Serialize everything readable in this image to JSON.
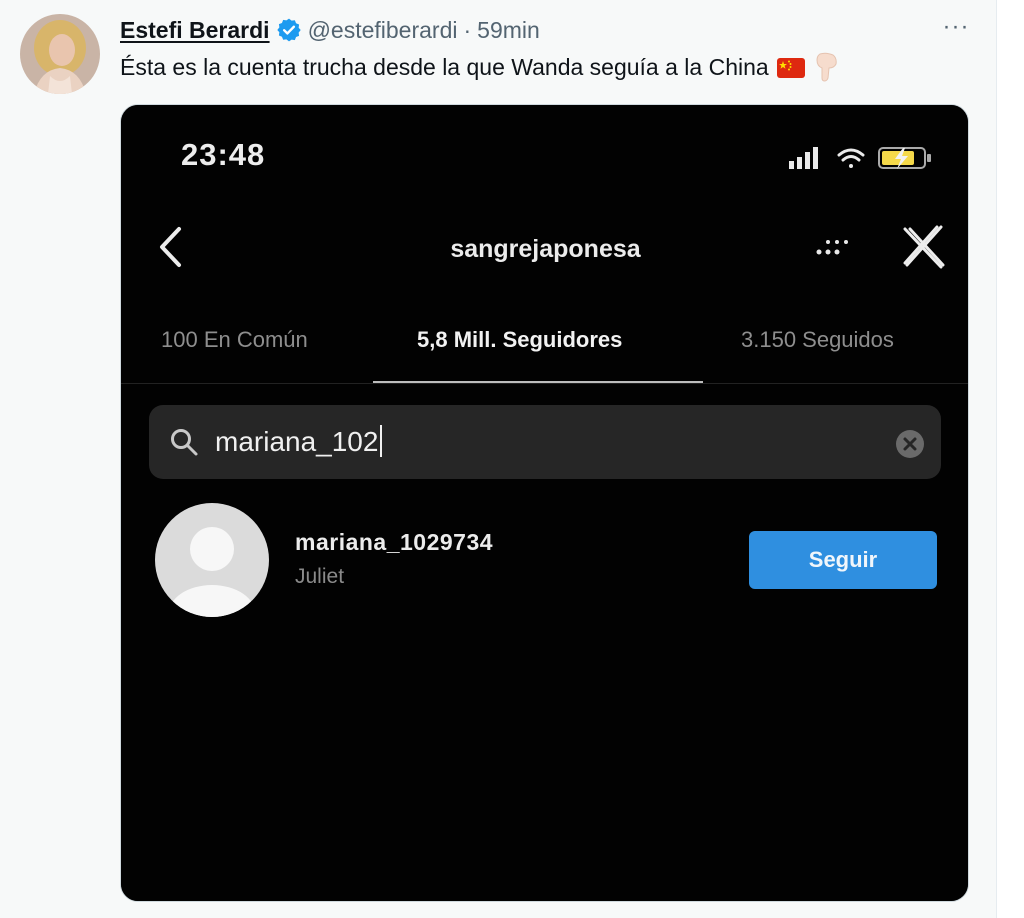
{
  "tweet": {
    "display_name": "Estefi Berardi",
    "handle": "@estefiberardi",
    "separator": "·",
    "time": "59min",
    "text": "Ésta es la cuenta trucha desde la que Wanda seguía a la China",
    "more_label": "···"
  },
  "phone": {
    "clock": "23:48",
    "profile_name": "sangrejaponesa",
    "tabs": [
      {
        "label": "100 En Común"
      },
      {
        "label": "5,8 Mill. Seguidores"
      },
      {
        "label": "3.150 Seguidos"
      }
    ],
    "search": {
      "value": "mariana_102"
    },
    "result": {
      "username": "mariana_1029734",
      "full_name": "Juliet",
      "follow_label": "Seguir"
    }
  },
  "colors": {
    "verified": "#1d9bf0",
    "follow_button": "#2f8fe0",
    "battery": "#f5d94a"
  },
  "icons": [
    "verified-badge-icon",
    "china-flag-icon",
    "pointing-down-hand-icon",
    "signal-icon",
    "wifi-icon",
    "battery-charging-icon",
    "back-chevron-icon",
    "more-dots-icon",
    "close-icon",
    "search-icon",
    "clear-icon",
    "default-avatar-icon"
  ]
}
